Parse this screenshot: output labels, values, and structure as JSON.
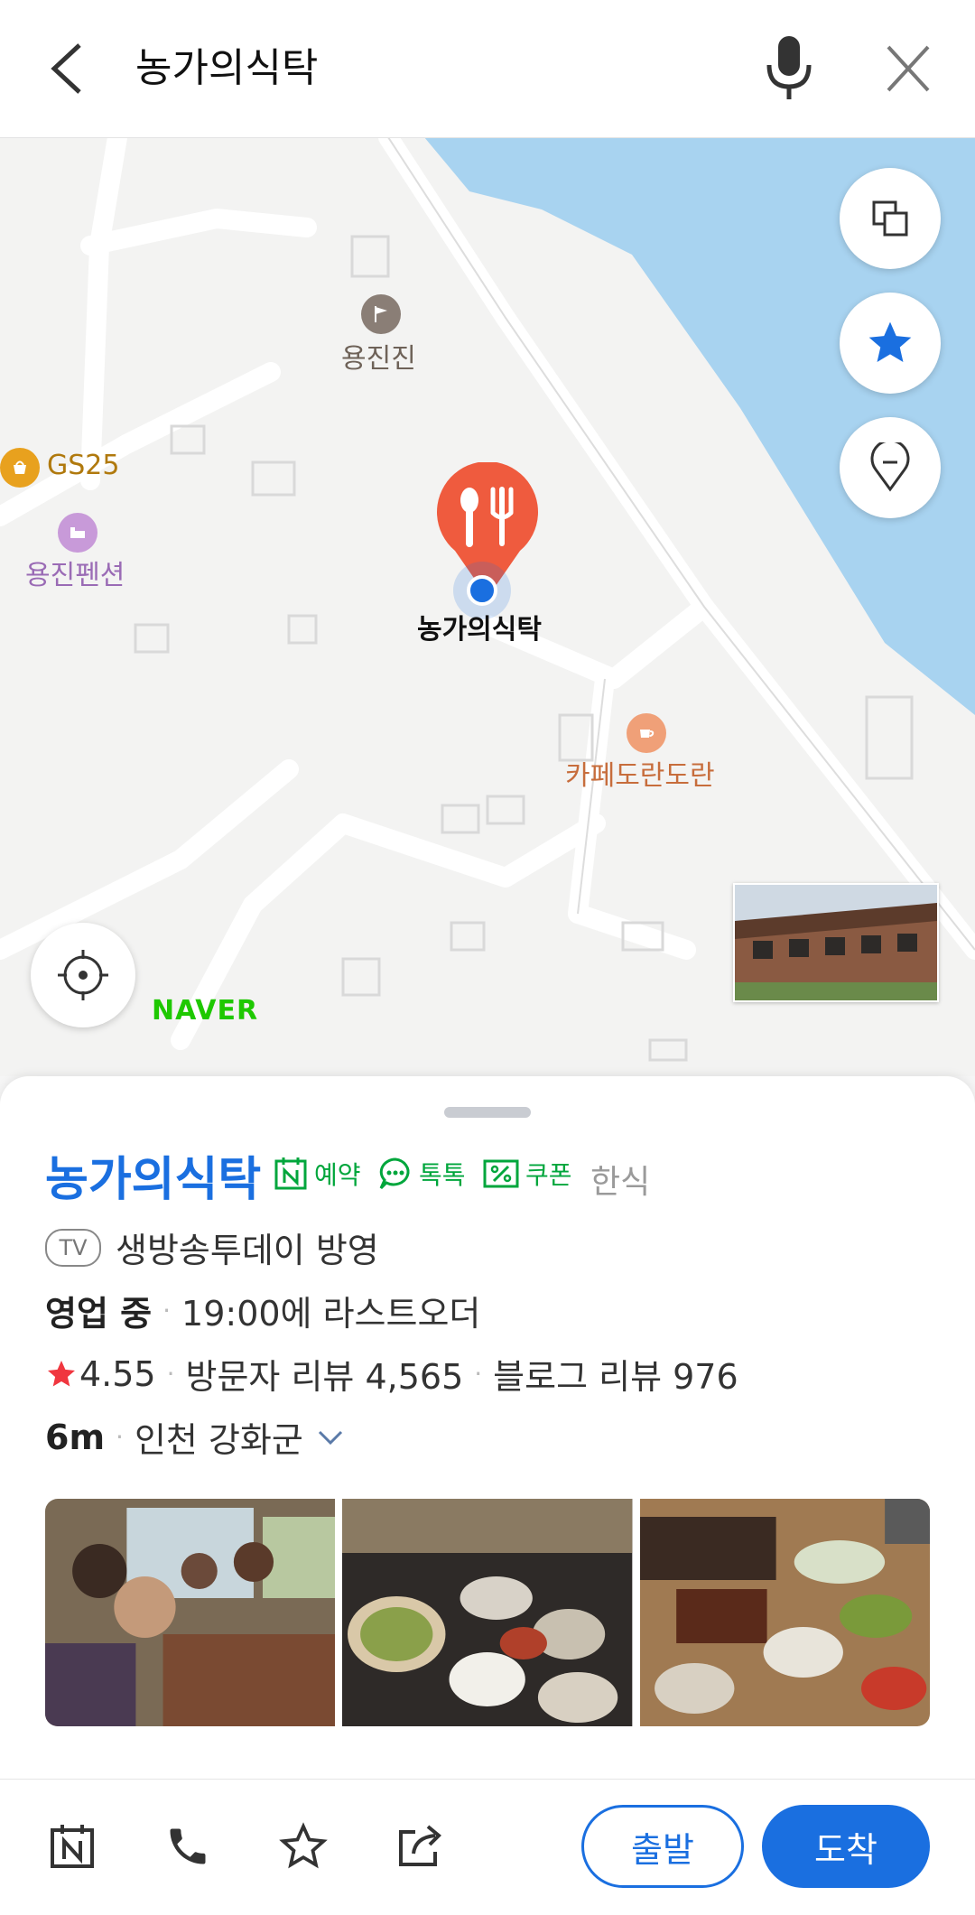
{
  "search": {
    "query": "농가의식탁"
  },
  "map": {
    "pois": {
      "yongjinjin": "용진진",
      "gs25": "GS25",
      "yongjin_pension": "용진펜션",
      "selected_place": "농가의식탁",
      "cafe": "카페도란도란"
    },
    "brand": "NAVER",
    "water_color": "#a8d3f0",
    "marker_color": "#ef5b3e"
  },
  "place": {
    "name": "농가의식탁",
    "badges": {
      "reserve": "예약",
      "talk": "톡톡",
      "coupon": "쿠폰"
    },
    "category": "한식",
    "tv": {
      "icon_text": "TV",
      "text": "생방송투데이 방영"
    },
    "status": {
      "open": "영업 중",
      "last_order": "19:00에 라스트오더"
    },
    "rating": "4.55",
    "visitor_reviews": "방문자 리뷰 4,565",
    "blog_reviews": "블로그 리뷰 976",
    "distance": "6m",
    "address": "인천 강화군"
  },
  "actions": {
    "depart": "출발",
    "arrive": "도착"
  },
  "colors": {
    "accent": "#1a6fe0",
    "naver_green": "#1ec800",
    "badge_green": "#00a63c"
  }
}
